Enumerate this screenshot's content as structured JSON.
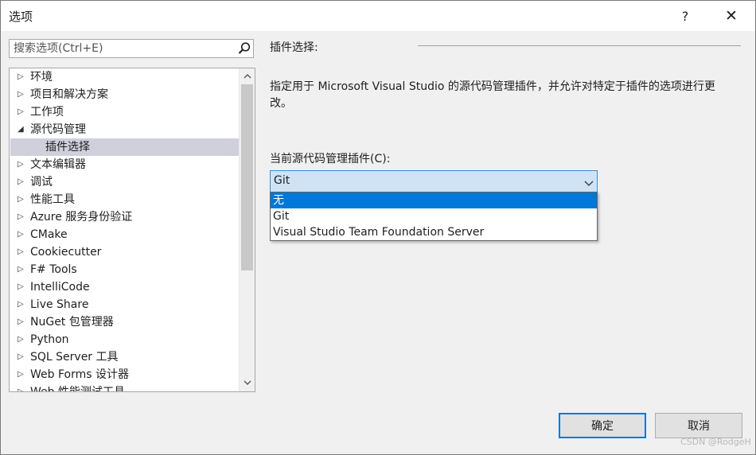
{
  "dialog": {
    "title": "选项",
    "help_glyph": "?",
    "close_glyph": "✕"
  },
  "search": {
    "placeholder": "搜索选项(Ctrl+E)",
    "value": ""
  },
  "tree": {
    "items": [
      {
        "label": "环境",
        "expander": "▷"
      },
      {
        "label": "项目和解决方案",
        "expander": "▷"
      },
      {
        "label": "工作项",
        "expander": "▷"
      },
      {
        "label": "源代码管理",
        "expander": "◢"
      },
      {
        "label": "插件选择",
        "expander": ""
      },
      {
        "label": "文本编辑器",
        "expander": "▷"
      },
      {
        "label": "调试",
        "expander": "▷"
      },
      {
        "label": "性能工具",
        "expander": "▷"
      },
      {
        "label": "Azure 服务身份验证",
        "expander": "▷"
      },
      {
        "label": "CMake",
        "expander": "▷"
      },
      {
        "label": "Cookiecutter",
        "expander": "▷"
      },
      {
        "label": "F# Tools",
        "expander": "▷"
      },
      {
        "label": "IntelliCode",
        "expander": "▷"
      },
      {
        "label": "Live Share",
        "expander": "▷"
      },
      {
        "label": "NuGet 包管理器",
        "expander": "▷"
      },
      {
        "label": "Python",
        "expander": "▷"
      },
      {
        "label": "SQL Server 工具",
        "expander": "▷"
      },
      {
        "label": "Web Forms 设计器",
        "expander": "▷"
      },
      {
        "label": "Web 性能测试工具",
        "expander": "▷"
      }
    ],
    "selected": "插件选择"
  },
  "panel": {
    "section_title": "插件选择:",
    "description": "指定用于 Microsoft Visual Studio 的源代码管理插件，并允许对特定于插件的选项进行更改。",
    "plugin_label": "当前源代码管理插件(C):",
    "plugin_selected": "Git",
    "plugin_options": [
      "无",
      "Git",
      "Visual Studio Team Foundation Server"
    ],
    "highlighted_option": "无"
  },
  "buttons": {
    "ok": "确定",
    "cancel": "取消"
  },
  "watermark": "CSDN @RodgeH",
  "colors": {
    "accent": "#0078d7",
    "selected_tree_item": "#d0d0dc",
    "combo_background": "#cfe3f5"
  }
}
